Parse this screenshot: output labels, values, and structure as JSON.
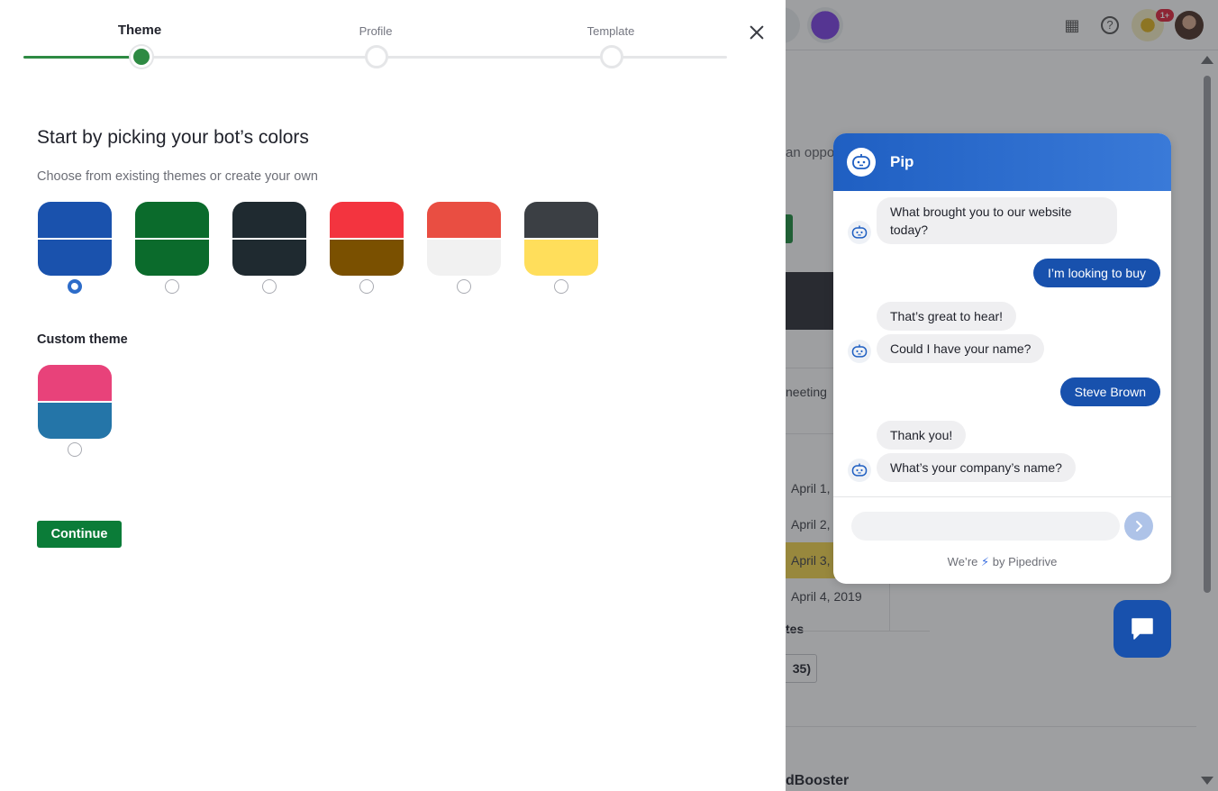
{
  "wizard": {
    "steps": [
      {
        "label": "Theme",
        "state": "active"
      },
      {
        "label": "Profile",
        "state": "pending"
      },
      {
        "label": "Template",
        "state": "pending"
      }
    ],
    "progress_fraction": 0.17
  },
  "content": {
    "heading": "Start by picking your bot’s colors",
    "subheading": "Choose from existing themes or create your own",
    "custom_title": "Custom theme",
    "continue_label": "Continue"
  },
  "themes": [
    {
      "top": "#1a52ad",
      "bottom": "#1a52ad",
      "selected": true
    },
    {
      "top": "#0b6b2c",
      "bottom": "#0b6b2c",
      "selected": false
    },
    {
      "top": "#1f2a30",
      "bottom": "#1f2a30",
      "selected": false
    },
    {
      "top": "#f3343f",
      "bottom": "#7a5000",
      "selected": false
    },
    {
      "top": "#e94e42",
      "bottom": "#f1f1f1",
      "selected": false
    },
    {
      "top": "#3b3f44",
      "bottom": "#ffde5b",
      "selected": false
    }
  ],
  "custom_theme": {
    "top": "#e8427a",
    "bottom": "#2475a8",
    "selected": false
  },
  "chat_preview": {
    "bot_name": "Pip",
    "messages": [
      {
        "from": "bot",
        "text": "What brought you to our website today?"
      },
      {
        "from": "user",
        "text": "I’m looking to buy"
      },
      {
        "from": "bot",
        "text": "That’s great to hear!"
      },
      {
        "from": "bot",
        "text": "Could I have your name?"
      },
      {
        "from": "user",
        "text": "Steve Brown"
      },
      {
        "from": "bot",
        "text": "Thank you!"
      },
      {
        "from": "bot",
        "text": "What’s your company’s name?"
      }
    ],
    "input_placeholder": "",
    "powered_prefix": "We’re",
    "powered_suffix": "by Pipedrive"
  },
  "background": {
    "notification_badge": "1+",
    "partial_texts": [
      "an oppo",
      "neeting",
      "tes",
      "35)",
      "dBooster"
    ],
    "dates": [
      "April 1,",
      "April 2,",
      "April 3,",
      "April 4, 2019"
    ]
  },
  "icons": {
    "close": "close-icon",
    "send": "chevron-right-icon",
    "bot": "bot-face-icon",
    "launcher": "chat-bubble-icon"
  }
}
